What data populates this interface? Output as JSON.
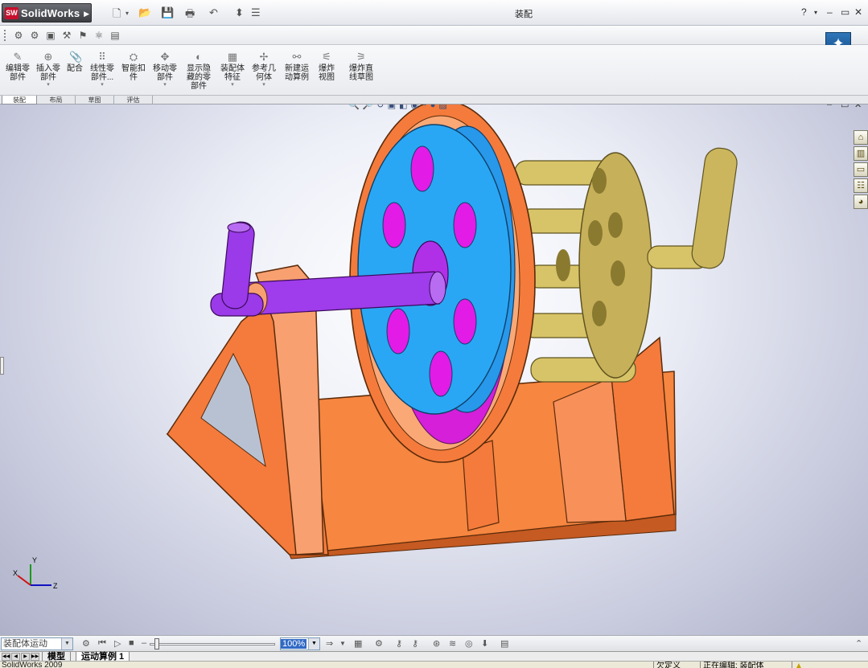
{
  "app": {
    "brand": "SolidWorks",
    "brand_badge": "SW",
    "window_title": "装配"
  },
  "title_controls": {
    "help": "?",
    "minimize": "–",
    "restore": "▭",
    "close": "✕"
  },
  "command_manager": {
    "buttons": [
      {
        "label": "编辑零部件",
        "icon": "edit-component-icon"
      },
      {
        "label": "插入零部件",
        "icon": "insert-component-icon"
      },
      {
        "label": "配合",
        "icon": "mate-icon"
      },
      {
        "label": "线性零部件...",
        "icon": "linear-pattern-icon"
      },
      {
        "label": "智能扣件",
        "icon": "smart-fasteners-icon"
      },
      {
        "label": "移动零部件",
        "icon": "move-component-icon"
      },
      {
        "label": "显示隐藏的零部件",
        "icon": "show-hidden-icon"
      },
      {
        "label": "装配体特征",
        "icon": "assembly-features-icon"
      },
      {
        "label": "参考几何体",
        "icon": "reference-geometry-icon"
      },
      {
        "label": "新建运动算例",
        "icon": "new-motion-study-icon"
      },
      {
        "label": "爆炸视图",
        "icon": "exploded-view-icon"
      },
      {
        "label": "爆炸直线草图",
        "icon": "explode-line-sketch-icon"
      }
    ],
    "tabs": [
      "装配",
      "布局",
      "草图",
      "评估"
    ],
    "active_tab": 0
  },
  "viewport": {
    "triad": {
      "x": "X",
      "y": "Y",
      "z": "Z"
    },
    "colors": {
      "base": "#f47b3c",
      "wheel": "#27a4f0",
      "holes": "#e21be7",
      "shaft": "#9a3ae8",
      "cage": "#c8b25a",
      "background": "#c7cadd"
    }
  },
  "motion_manager": {
    "study_type": "装配体运动",
    "zoom": "100%"
  },
  "sheet_tabs": {
    "model": "模型",
    "motion_study": "运动算例 1"
  },
  "status": {
    "app_version": "SolidWorks 2009",
    "under_defined": "欠定义",
    "editing": "正在编辑: 装配体"
  }
}
